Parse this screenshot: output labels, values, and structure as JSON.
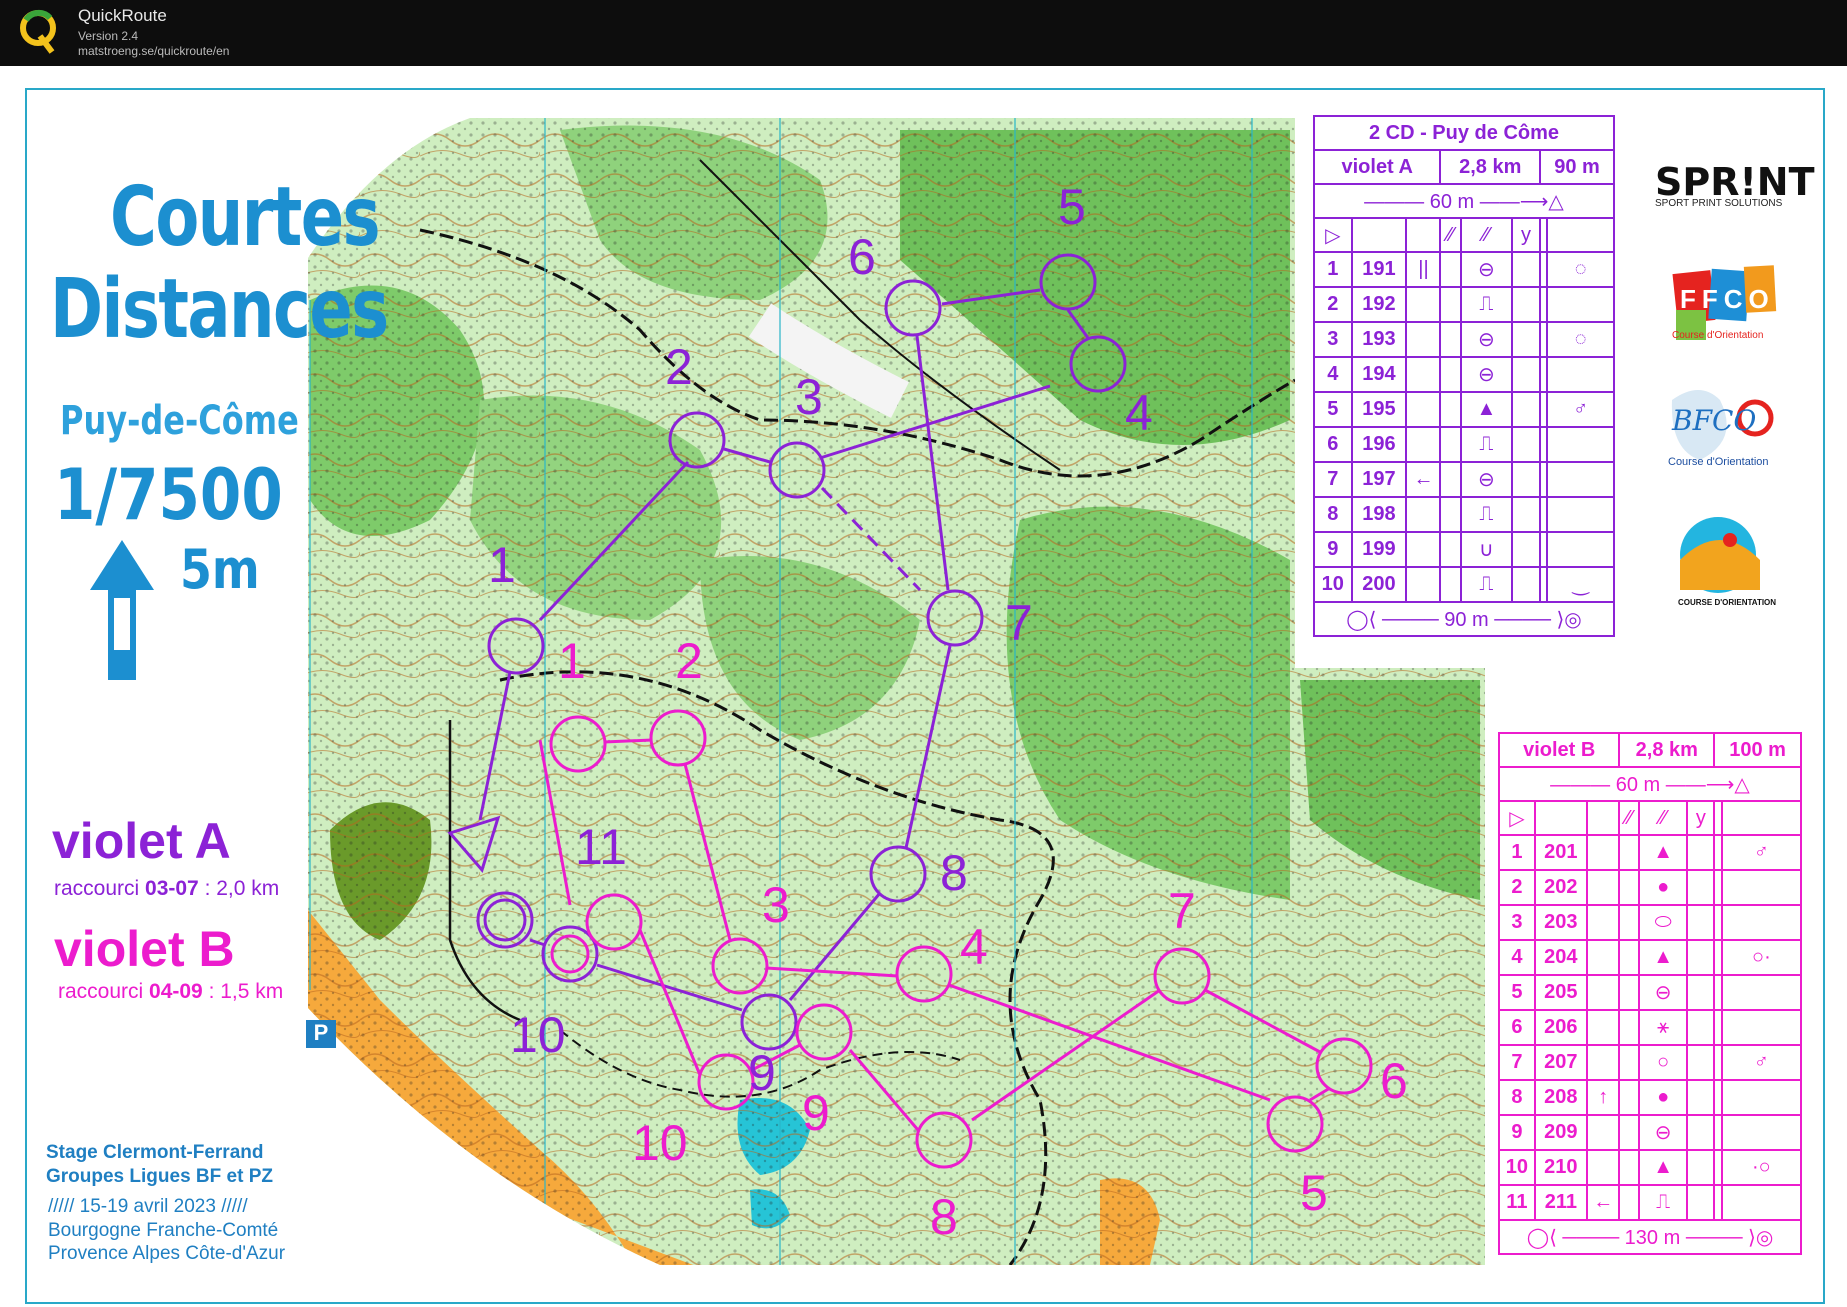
{
  "app": {
    "name": "QuickRoute",
    "version": "Version 2.4",
    "url": "matstroeng.se/quickroute/en"
  },
  "map": {
    "title_line1": "Courtes",
    "title_line2": "Distances",
    "place": "Puy-de-Côme",
    "scale": "1/7500",
    "equidistance": "5m",
    "north_icon": "north-arrow-icon",
    "parking_icon": "parking-icon",
    "parking_label": "P",
    "course_a": {
      "name": "violet A",
      "shortcut_prefix": "raccourci ",
      "shortcut_legs": "03-07",
      "shortcut_suffix": " : 2,0 km",
      "color": "#8c22d6"
    },
    "course_b": {
      "name": "violet B",
      "shortcut_prefix": "raccourci ",
      "shortcut_legs": "04-09",
      "shortcut_suffix": " : 1,5 km",
      "color": "#ec1ccd"
    },
    "stage": {
      "line1": "Stage Clermont-Ferrand",
      "line2": "Groupes Ligues BF et PZ",
      "line3": "///// 15-19 avril 2023  /////",
      "line4": "Bourgogne Franche-Comté",
      "line5": "Provence Alpes Côte-d'Azur"
    },
    "sponsors": {
      "sprint": "SPR!NT",
      "sprint_sub": "SPORT PRINT SOLUTIONS",
      "ffco": "FFCO",
      "ffco_sub": "Course d'Orientation",
      "bfco": "BFCO",
      "bfco_sub": "Course d'Orientation",
      "paca_sub": "COURSE D'ORIENTATION"
    },
    "control_numbers_a": [
      "1",
      "2",
      "3",
      "4",
      "5",
      "6",
      "7",
      "8",
      "9",
      "10",
      "11"
    ],
    "control_numbers_b": [
      "1",
      "2",
      "3",
      "4",
      "5",
      "6",
      "7",
      "8",
      "9",
      "10"
    ]
  },
  "description_a": {
    "event": "2 CD - Puy de Côme",
    "course": "violet A",
    "length": "2,8 km",
    "climb": "90 m",
    "start_marking": "60 m",
    "finish": "90 m",
    "controls": [
      {
        "n": "1",
        "code": "191",
        "c": "||",
        "d": "⊖",
        "g": "◌"
      },
      {
        "n": "2",
        "code": "192",
        "c": "",
        "d": "⎍",
        "g": ""
      },
      {
        "n": "3",
        "code": "193",
        "c": "",
        "d": "⊖",
        "g": "◌"
      },
      {
        "n": "4",
        "code": "194",
        "c": "",
        "d": "⊖",
        "g": ""
      },
      {
        "n": "5",
        "code": "195",
        "c": "",
        "d": "▲",
        "g": "♂"
      },
      {
        "n": "6",
        "code": "196",
        "c": "",
        "d": "⎍",
        "g": ""
      },
      {
        "n": "7",
        "code": "197",
        "c": "←",
        "d": "⊖",
        "g": ""
      },
      {
        "n": "8",
        "code": "198",
        "c": "",
        "d": "⎍",
        "g": ""
      },
      {
        "n": "9",
        "code": "199",
        "c": "",
        "d": "∪",
        "g": ""
      },
      {
        "n": "10",
        "code": "200",
        "c": "",
        "d": "⎍",
        "g": "‿"
      }
    ]
  },
  "description_b": {
    "course": "violet B",
    "length": "2,8 km",
    "climb": "100 m",
    "start_marking": "60 m",
    "finish": "130 m",
    "controls": [
      {
        "n": "1",
        "code": "201",
        "c": "",
        "d": "▲",
        "g": "♂"
      },
      {
        "n": "2",
        "code": "202",
        "c": "",
        "d": "●",
        "g": ""
      },
      {
        "n": "3",
        "code": "203",
        "c": "",
        "d": "⬭",
        "g": ""
      },
      {
        "n": "4",
        "code": "204",
        "c": "",
        "d": "▲",
        "g": "○·"
      },
      {
        "n": "5",
        "code": "205",
        "c": "",
        "d": "⊖",
        "g": ""
      },
      {
        "n": "6",
        "code": "206",
        "c": "",
        "d": "⚹",
        "g": ""
      },
      {
        "n": "7",
        "code": "207",
        "c": "",
        "d": "○",
        "g": "♂"
      },
      {
        "n": "8",
        "code": "208",
        "c": "↑",
        "d": "●",
        "g": ""
      },
      {
        "n": "9",
        "code": "209",
        "c": "",
        "d": "⊖",
        "g": ""
      },
      {
        "n": "10",
        "code": "210",
        "c": "",
        "d": "▲",
        "g": "·○"
      },
      {
        "n": "11",
        "code": "211",
        "c": "←",
        "d": "⎍",
        "g": ""
      }
    ]
  }
}
